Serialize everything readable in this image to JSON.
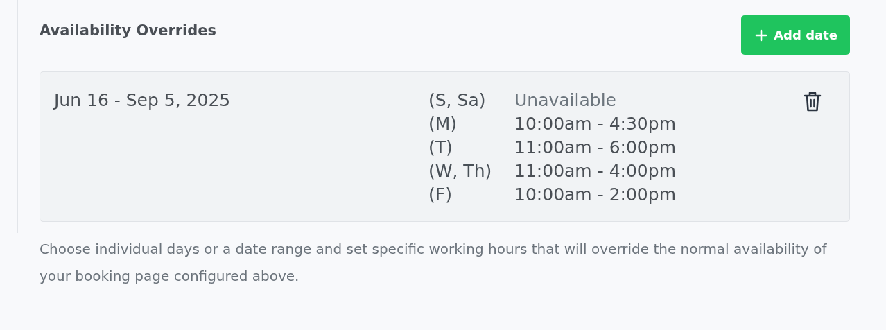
{
  "section": {
    "title": "Availability Overrides",
    "add_button": {
      "label": "Add date"
    }
  },
  "overrides": [
    {
      "date_range": "Jun 16 - Sep 5, 2025",
      "schedule": [
        {
          "days": "(S, Sa)",
          "hours": "Unavailable",
          "kind": "unavailable"
        },
        {
          "days": "(M)",
          "hours": "10:00am - 4:30pm",
          "kind": "hours"
        },
        {
          "days": "(T)",
          "hours": "11:00am - 6:00pm",
          "kind": "hours"
        },
        {
          "days": "(W, Th)",
          "hours": "11:00am - 4:00pm",
          "kind": "hours"
        },
        {
          "days": "(F)",
          "hours": "10:00am - 2:00pm",
          "kind": "hours"
        }
      ]
    }
  ],
  "description": "Choose individual days or a date range and set specific working hours that will override the normal availability of your booking page configured above."
}
